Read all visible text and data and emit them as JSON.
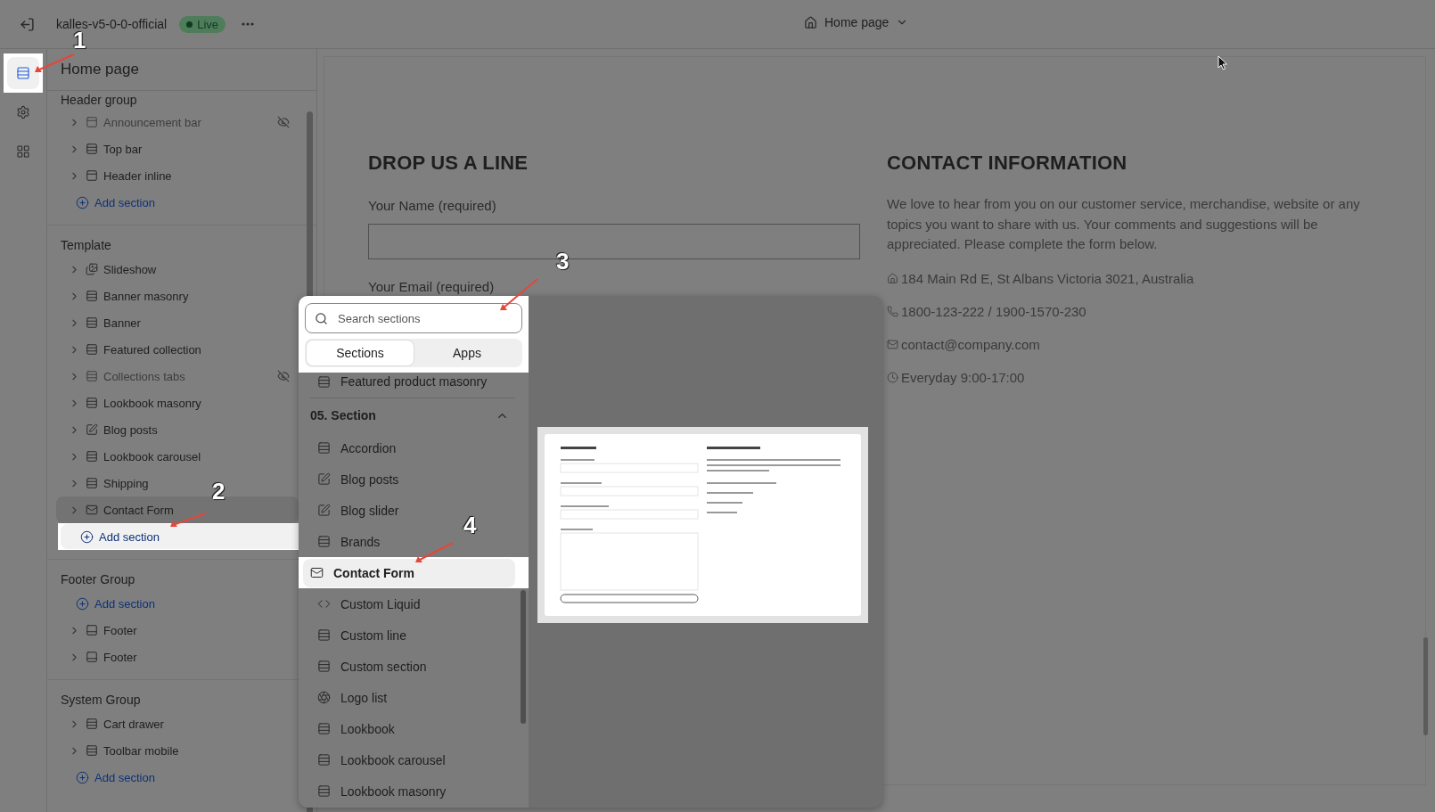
{
  "topbar": {
    "store_name": "kalles-v5-0-0-official",
    "status": "Live",
    "page_selector": "Home page"
  },
  "rail": [
    {
      "selected": true,
      "highlighted": true
    },
    {
      "selected": false,
      "highlighted": false
    },
    {
      "selected": false,
      "highlighted": false
    }
  ],
  "sidebar": {
    "title": "Home page",
    "groups": [
      {
        "title": "Header group",
        "items": [
          {
            "kind": "header",
            "label": "Announcement bar",
            "hidden": true,
            "selected": false
          },
          {
            "kind": "section",
            "label": "Top bar",
            "hidden": false,
            "selected": false
          },
          {
            "kind": "header",
            "label": "Header inline",
            "hidden": false,
            "selected": false
          },
          {
            "kind": "add",
            "label": "Add section",
            "highlighted": false
          }
        ]
      },
      {
        "title": "Template",
        "items": [
          {
            "kind": "slideshow",
            "label": "Slideshow",
            "hidden": false,
            "selected": false
          },
          {
            "kind": "section",
            "label": "Banner masonry",
            "hidden": false,
            "selected": false
          },
          {
            "kind": "section",
            "label": "Banner",
            "hidden": false,
            "selected": false
          },
          {
            "kind": "section",
            "label": "Featured collection",
            "hidden": false,
            "selected": false
          },
          {
            "kind": "section",
            "label": "Collections tabs",
            "hidden": true,
            "selected": false
          },
          {
            "kind": "section",
            "label": "Lookbook masonry",
            "hidden": false,
            "selected": false
          },
          {
            "kind": "blog",
            "label": "Blog posts",
            "hidden": false,
            "selected": false
          },
          {
            "kind": "section",
            "label": "Lookbook carousel",
            "hidden": false,
            "selected": false
          },
          {
            "kind": "section",
            "label": "Shipping",
            "hidden": false,
            "selected": false
          },
          {
            "kind": "contact",
            "label": "Contact Form",
            "hidden": false,
            "selected": true
          },
          {
            "kind": "add",
            "label": "Add section",
            "highlighted": true
          }
        ]
      },
      {
        "title": "Footer Group",
        "items": [
          {
            "kind": "add",
            "label": "Add section",
            "highlighted": false
          },
          {
            "kind": "footer",
            "label": "Footer",
            "hidden": false,
            "selected": false
          },
          {
            "kind": "footer",
            "label": "Footer",
            "hidden": false,
            "selected": false
          }
        ]
      },
      {
        "title": "System Group",
        "items": [
          {
            "kind": "section",
            "label": "Cart drawer",
            "hidden": false,
            "selected": false
          },
          {
            "kind": "section",
            "label": "Toolbar mobile",
            "hidden": false,
            "selected": false
          },
          {
            "kind": "add",
            "label": "Add section",
            "highlighted": false
          }
        ]
      }
    ]
  },
  "canvas": {
    "form": {
      "heading": "DROP US A LINE",
      "fields": [
        {
          "label": "Your Name (required)"
        },
        {
          "label": "Your Email (required)"
        }
      ]
    },
    "info": {
      "heading": "CONTACT INFORMATION",
      "text": "We love to hear from you on our customer service, merchandise, website or any topics you want to share with us. Your comments and suggestions will be appreciated. Please complete the form below.",
      "lines": [
        {
          "text": "184 Main Rd E, St Albans Victoria 3021, Australia"
        },
        {
          "text": "1800-123-222 / 1900-1570-230"
        },
        {
          "text": "contact@company.com"
        },
        {
          "text": "Everyday 9:00-17:00"
        }
      ]
    }
  },
  "popup": {
    "search": {
      "placeholder": "Search sections"
    },
    "tabs": [
      {
        "label": "Sections",
        "selected": true
      },
      {
        "label": "Apps",
        "selected": false
      }
    ],
    "top_item": {
      "kind": "section",
      "label": "Featured product masonry"
    },
    "category": {
      "title": "05. Section",
      "expanded": true
    },
    "items": [
      {
        "kind": "section",
        "label": "Accordion",
        "selected": false
      },
      {
        "kind": "blog",
        "label": "Blog posts",
        "selected": false
      },
      {
        "kind": "blog",
        "label": "Blog slider",
        "selected": false
      },
      {
        "kind": "section",
        "label": "Brands",
        "selected": false
      },
      {
        "kind": "contact",
        "label": "Contact Form",
        "selected": true
      },
      {
        "kind": "code",
        "label": "Custom Liquid",
        "selected": false
      },
      {
        "kind": "section",
        "label": "Custom line",
        "selected": false
      },
      {
        "kind": "section",
        "label": "Custom section",
        "selected": false
      },
      {
        "kind": "logo",
        "label": "Logo list",
        "selected": false
      },
      {
        "kind": "section",
        "label": "Lookbook",
        "selected": false
      },
      {
        "kind": "section",
        "label": "Lookbook carousel",
        "selected": false
      },
      {
        "kind": "section",
        "label": "Lookbook masonry",
        "selected": false
      }
    ]
  },
  "annotations": [
    {
      "label": "1"
    },
    {
      "label": "2"
    },
    {
      "label": "3"
    },
    {
      "label": "4"
    }
  ]
}
